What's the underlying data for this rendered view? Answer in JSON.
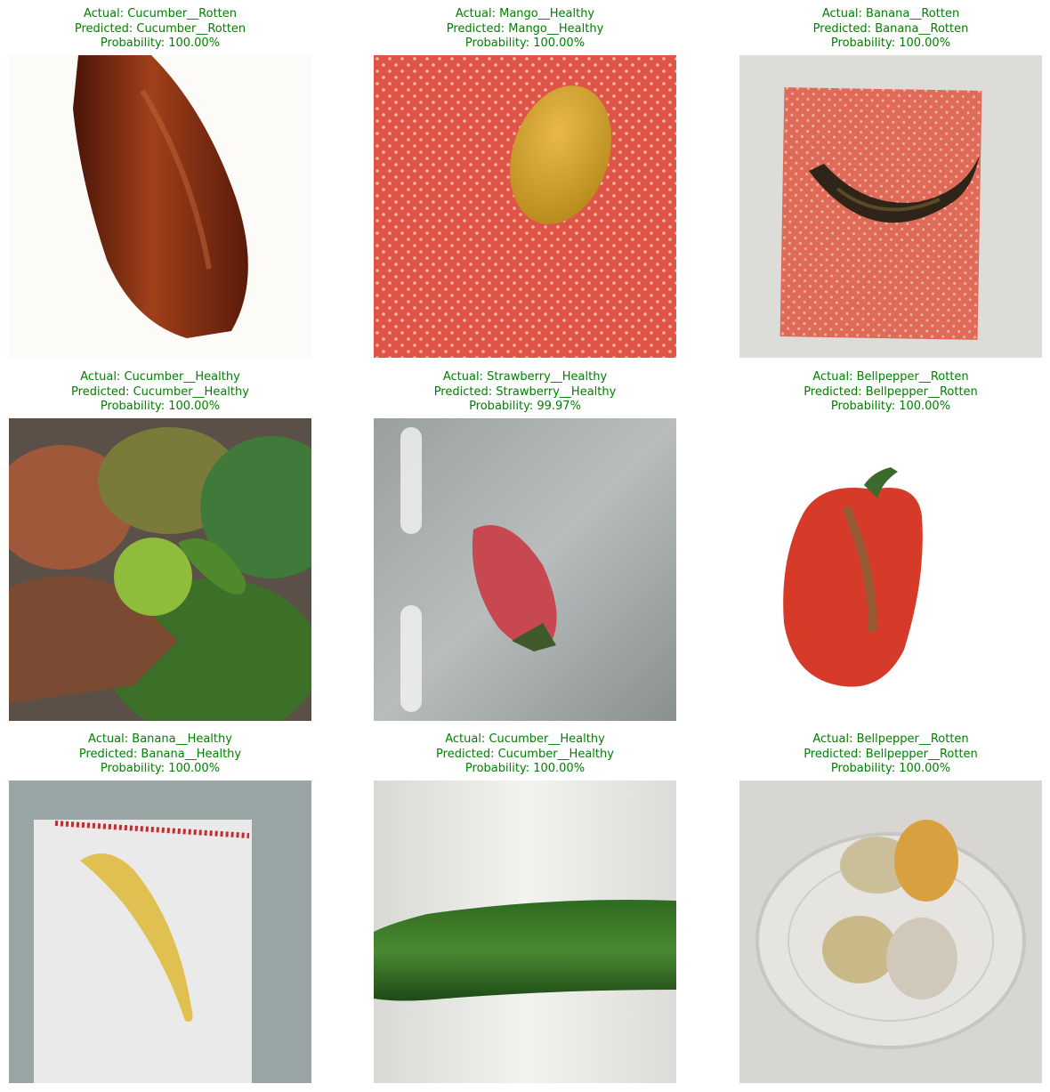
{
  "colors": {
    "caption": "#008000"
  },
  "panels": [
    {
      "actual": "Actual: Cucumber__Rotten",
      "predicted": "Predicted: Cucumber__Rotten",
      "probability": "Probability: 100.00%"
    },
    {
      "actual": "Actual: Mango__Healthy",
      "predicted": "Predicted: Mango__Healthy",
      "probability": "Probability: 100.00%"
    },
    {
      "actual": "Actual: Banana__Rotten",
      "predicted": "Predicted: Banana__Rotten",
      "probability": "Probability: 100.00%"
    },
    {
      "actual": "Actual: Cucumber__Healthy",
      "predicted": "Predicted: Cucumber__Healthy",
      "probability": "Probability: 100.00%"
    },
    {
      "actual": "Actual: Strawberry__Healthy",
      "predicted": "Predicted: Strawberry__Healthy",
      "probability": "Probability: 99.97%"
    },
    {
      "actual": "Actual: Bellpepper__Rotten",
      "predicted": "Predicted: Bellpepper__Rotten",
      "probability": "Probability: 100.00%"
    },
    {
      "actual": "Actual: Banana__Healthy",
      "predicted": "Predicted: Banana__Healthy",
      "probability": "Probability: 100.00%"
    },
    {
      "actual": "Actual: Cucumber__Healthy",
      "predicted": "Predicted: Cucumber__Healthy",
      "probability": "Probability: 100.00%"
    },
    {
      "actual": "Actual: Bellpepper__Rotten",
      "predicted": "Predicted: Bellpepper__Rotten",
      "probability": "Probability: 100.00%"
    }
  ]
}
